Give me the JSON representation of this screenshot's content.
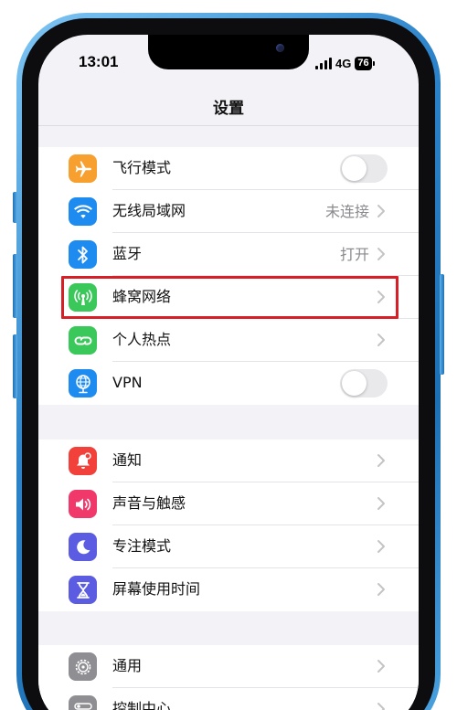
{
  "status_bar": {
    "time": "13:01",
    "network": "4G",
    "battery": "76"
  },
  "nav": {
    "title": "设置"
  },
  "groups": [
    {
      "items": [
        {
          "label": "飞行模式",
          "icon": "airplane-icon",
          "color": "#f7a02f",
          "control": "toggle",
          "on": false
        },
        {
          "label": "无线局域网",
          "icon": "wifi-icon",
          "color": "#1e8bf0",
          "value": "未连接",
          "control": "chevron"
        },
        {
          "label": "蓝牙",
          "icon": "bluetooth-icon",
          "color": "#1e8bf0",
          "value": "打开",
          "control": "chevron"
        },
        {
          "label": "蜂窝网络",
          "icon": "cellular-icon",
          "color": "#3ac85a",
          "control": "chevron",
          "highlighted": true
        },
        {
          "label": "个人热点",
          "icon": "hotspot-icon",
          "color": "#3ac85a",
          "control": "chevron"
        },
        {
          "label": "VPN",
          "icon": "vpn-globe-icon",
          "color": "#1e8bf0",
          "control": "toggle",
          "on": false
        }
      ]
    },
    {
      "items": [
        {
          "label": "通知",
          "icon": "notification-bell-icon",
          "color": "#f2413a",
          "control": "chevron"
        },
        {
          "label": "声音与触感",
          "icon": "speaker-icon",
          "color": "#f0396a",
          "control": "chevron"
        },
        {
          "label": "专注模式",
          "icon": "moon-icon",
          "color": "#5b5ce2",
          "control": "chevron"
        },
        {
          "label": "屏幕使用时间",
          "icon": "hourglass-icon",
          "color": "#5b5ce2",
          "control": "chevron"
        }
      ]
    },
    {
      "items": [
        {
          "label": "通用",
          "icon": "gear-icon",
          "color": "#8e8e93",
          "control": "chevron"
        },
        {
          "label": "控制中心",
          "icon": "control-center-icon",
          "color": "#8e8e93",
          "control": "chevron"
        }
      ]
    }
  ],
  "colors": {
    "highlight_border": "#d61f26",
    "frame": "#2c83c9"
  }
}
